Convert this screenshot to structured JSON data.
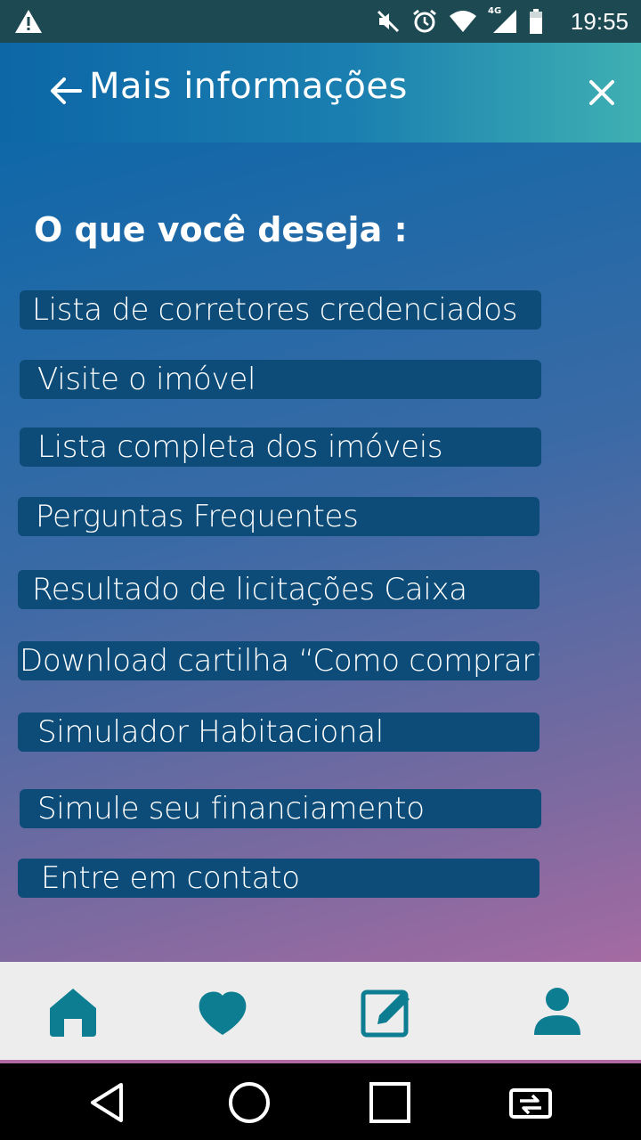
{
  "status_bar": {
    "time": "19:55",
    "network": "4G"
  },
  "app_bar": {
    "title": "Mais informações"
  },
  "heading": "O que você deseja :",
  "menu": [
    "Lista de corretores credenciados",
    "Visite o imóvel",
    "Lista completa dos imóveis",
    "Perguntas Frequentes",
    "Resultado de licitações Caixa",
    "Download cartilha “Como comprar”",
    "Simulador Habitacional",
    "Simule seu financiamento",
    "Entre em contato"
  ],
  "bottom_nav": {
    "icons": [
      "home-icon",
      "heart-icon",
      "edit-icon",
      "person-icon"
    ],
    "accent": "#0d7d91"
  },
  "colors": {
    "button_bg": "#0d4c78",
    "app_bar_start": "#0d66a6",
    "app_bar_end": "#3fb0b2"
  }
}
